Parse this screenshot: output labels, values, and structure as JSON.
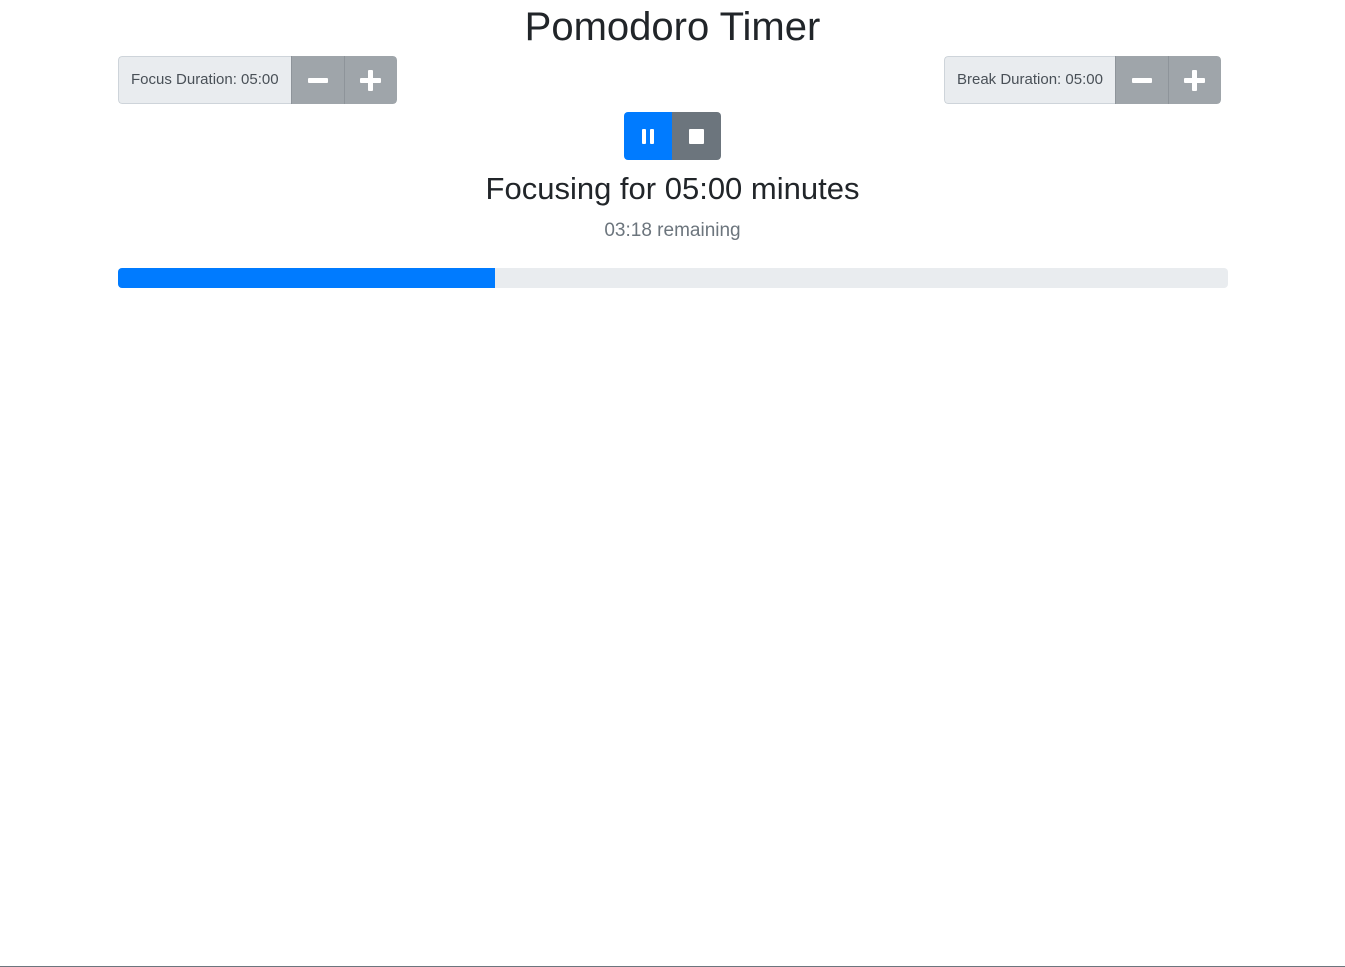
{
  "app": {
    "title": "Pomodoro Timer"
  },
  "focus": {
    "label": "Focus Duration: 05:00",
    "decrement_icon": "minus-icon",
    "increment_icon": "plus-icon"
  },
  "break": {
    "label": "Break Duration: 05:00",
    "decrement_icon": "minus-icon",
    "increment_icon": "plus-icon"
  },
  "controls": {
    "pause_icon": "pause-icon",
    "stop_icon": "stop-icon"
  },
  "session": {
    "heading": "Focusing for 05:00 minutes",
    "remaining": "03:18 remaining",
    "progress_percent": 34
  },
  "colors": {
    "primary": "#007bff",
    "secondary": "#6c757d",
    "adjust_button": "#9fa5aa",
    "track": "#e9ecef"
  }
}
